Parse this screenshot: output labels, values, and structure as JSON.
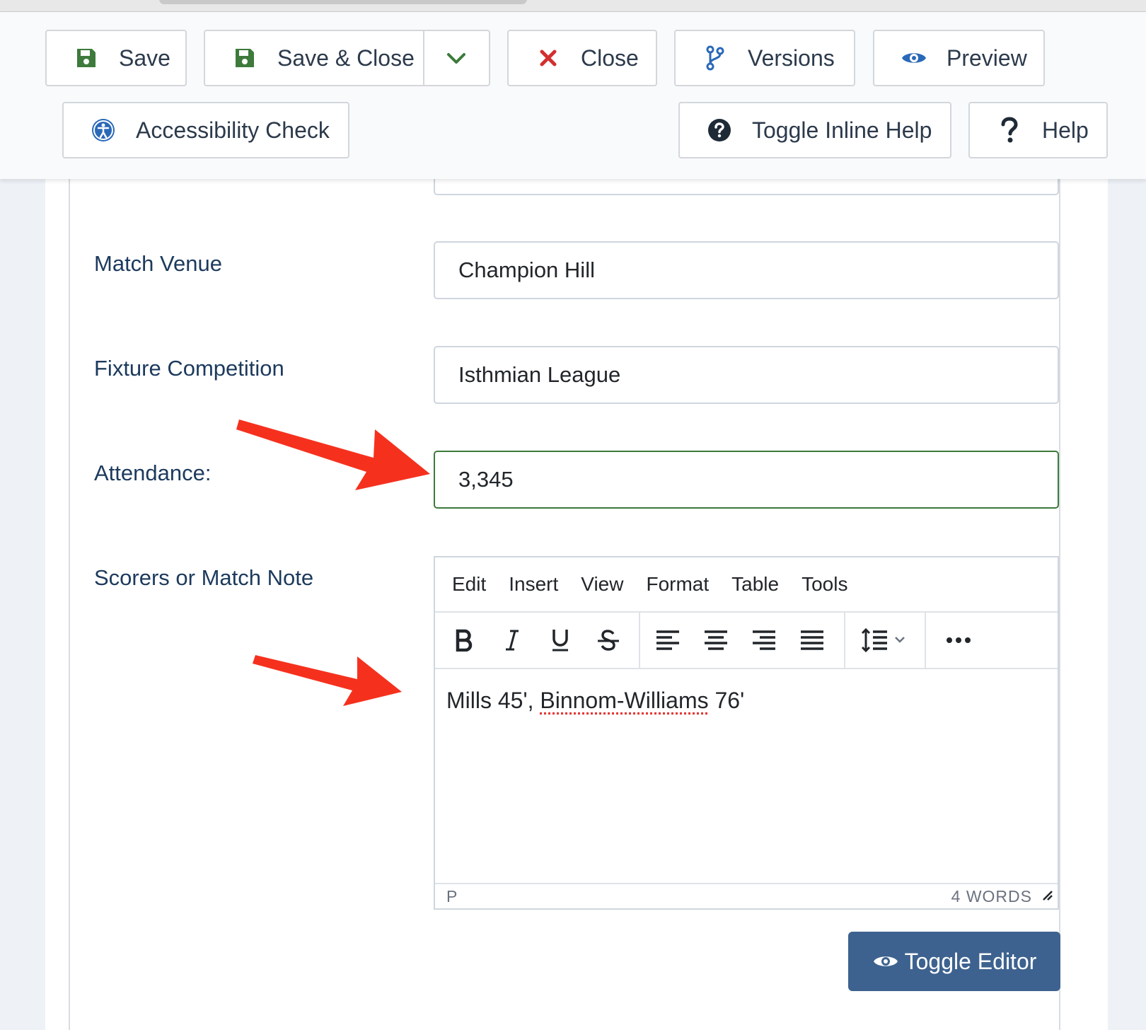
{
  "toolbar": {
    "save": "Save",
    "save_close": "Save & Close",
    "close": "Close",
    "versions": "Versions",
    "preview": "Preview",
    "accessibility_check": "Accessibility Check",
    "toggle_inline_help": "Toggle Inline Help",
    "help": "Help"
  },
  "form": {
    "match_venue": {
      "label": "Match Venue",
      "value": "Champion Hill"
    },
    "fixture_competition": {
      "label": "Fixture Competition",
      "value": "Isthmian League"
    },
    "attendance": {
      "label": "Attendance:",
      "value": "3,345"
    },
    "scorers": {
      "label": "Scorers or Match Note"
    }
  },
  "editor": {
    "menu": [
      "Edit",
      "Insert",
      "View",
      "Format",
      "Table",
      "Tools"
    ],
    "content_plain": "Mills 45', ",
    "content_misspelled": "Binnom-Williams",
    "content_tail": " 76'",
    "status_path": "P",
    "word_count": "4 WORDS",
    "toggle_label": "Toggle Editor"
  },
  "colors": {
    "accent_green": "#3d7a3b",
    "danger_red": "#d32f2f",
    "link_blue": "#2a69b8",
    "toggle_bg": "#3d628f",
    "annotation_arrow": "#f5311e"
  }
}
